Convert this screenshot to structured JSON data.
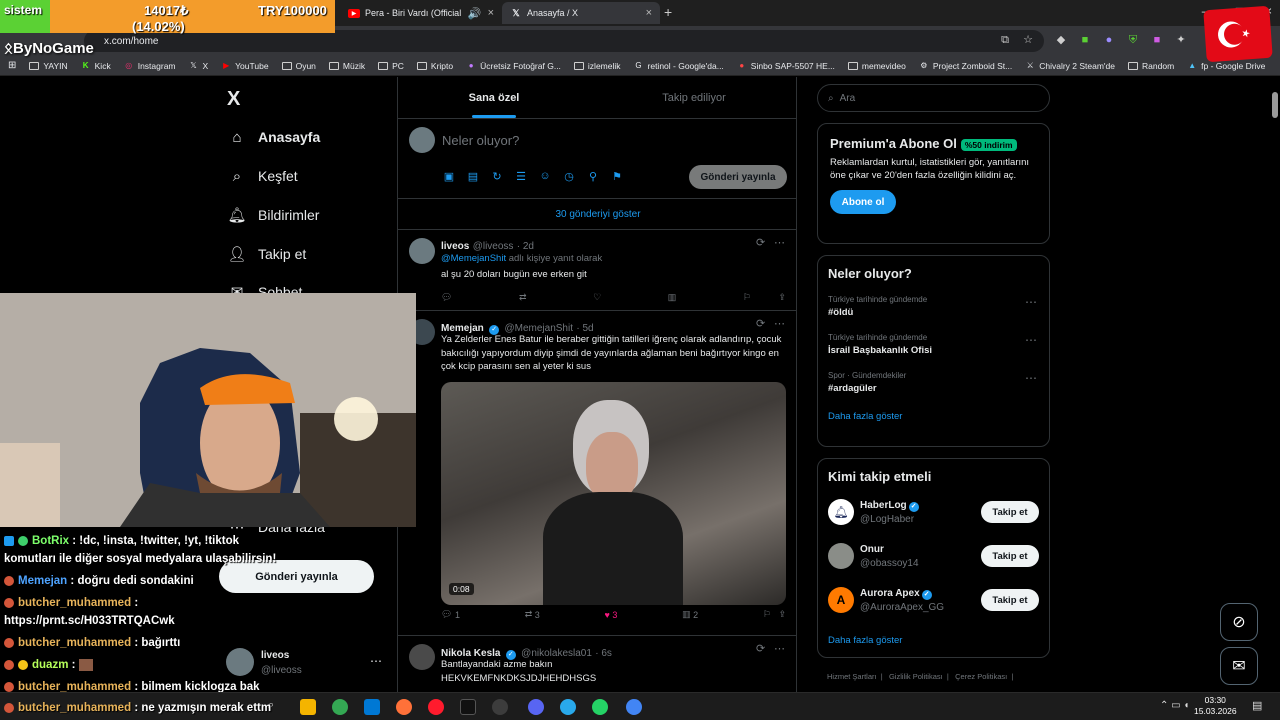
{
  "browser": {
    "tabs": [
      {
        "label": "Pera - Biri Vardı (Official Vid"
      },
      {
        "label": "Anasayfa / X"
      }
    ],
    "url": "x.com/home",
    "bookmarks": [
      "YAYIN",
      "Kick",
      "Instagram",
      "X",
      "YouTube",
      "Oyun",
      "Müzik",
      "PC",
      "Kripto",
      "Ücretsiz Fotoğraf G...",
      "izlemelik",
      "retinol - Google'da...",
      "Sinbo SAP-5507 HE...",
      "memevideo",
      "Project Zomboid St...",
      "Chivalry 2 Steam'de",
      "Random",
      "fp - Google Drive"
    ]
  },
  "stream_overlay": {
    "label": "sistem",
    "value": "14017₺",
    "percent": "(14.02%)",
    "goal": "TRY100000",
    "logo": "ByNoGame"
  },
  "sidebar": {
    "logo": "X",
    "items": [
      {
        "label": "Anasayfa",
        "icon": "home-icon"
      },
      {
        "label": "Keşfet",
        "icon": "search-icon"
      },
      {
        "label": "Bildirimler",
        "icon": "bell-icon"
      },
      {
        "label": "Takip et",
        "icon": "add-user-icon"
      },
      {
        "label": "Sohbet",
        "icon": "mail-icon"
      },
      {
        "label": "Daha fazla",
        "icon": "more-icon"
      }
    ],
    "post_button": "Gönderi yayınla",
    "account": {
      "name": "liveos",
      "handle": "@liveoss"
    }
  },
  "timeline": {
    "tabs": [
      "Sana özel",
      "Takip ediliyor"
    ],
    "compose_placeholder": "Neler oluyor?",
    "compose_button": "Gönderi yayınla",
    "show_more": "30 gönderiyi göster",
    "tweets": [
      {
        "name": "liveos",
        "handle": "@liveoss",
        "time": "· 2d",
        "reply_to": "@MemejanShit",
        "reply_suffix": " adlı kişiye yanıt olarak",
        "text": "al şu 20 doları bugün eve erken git"
      },
      {
        "name": "Memejan",
        "handle": "@MemejanShit",
        "time": "· 5d",
        "text": "Ya Zelderler Enes Batur ile beraber gittiğin tatilleri iğrenç olarak adlandırıp, çocuk bakıcılığı yapıyordum diyip şimdi de yayınlarda ağlaman beni bağırtıyor kingo en çok kcip parasını sen al yeter ki sus",
        "video_duration": "0:08",
        "replies": "1",
        "reposts": "3",
        "likes": "3",
        "views": "2"
      },
      {
        "name": "Nikola Kesla",
        "handle": "@nikolakesla01",
        "time": "· 6s",
        "text": "Bantlayandaki azme bakın\nHEKVKEMFNKDKSJDJHEHDHSGS"
      }
    ]
  },
  "right": {
    "search_placeholder": "Ara",
    "premium": {
      "title": "Premium'a Abone Ol",
      "badge": "%50 indirim",
      "text": "Reklamlardan kurtul, istatistikleri gör, yanıtlarını öne çıkar ve 20'den fazla özelliğin kilidini aç.",
      "button": "Abone ol"
    },
    "trends": {
      "title": "Neler oluyor?",
      "items": [
        {
          "context": "Türkiye tarihinde gündemde",
          "name": "#öldü"
        },
        {
          "context": "Türkiye tarihinde gündemde",
          "name": "İsrail Başbakanlık Ofisi"
        },
        {
          "context": "Spor · Gündemdekiler",
          "name": "#ardagüler"
        }
      ],
      "more": "Daha fazla göster"
    },
    "follow": {
      "title": "Kimi takip etmeli",
      "items": [
        {
          "name": "HaberLog",
          "handle": "@LogHaber",
          "verified": true
        },
        {
          "name": "Onur",
          "handle": "@obassoy14",
          "verified": false
        },
        {
          "name": "Aurora Apex",
          "handle": "@AuroraApex_GG",
          "verified": true
        }
      ],
      "button": "Takip et",
      "more": "Daha fazla göster"
    },
    "footer": [
      "Hizmet Şartları",
      "Gizlilik Politikası",
      "Çerez Politikası"
    ]
  },
  "chat": [
    {
      "user": "BotRix",
      "msg": ": !dc, !insta, !twitter, !yt, !tiktok"
    },
    {
      "user": "",
      "msg": "komutları ile diğer sosyal medyalara ulaşabilirsin!"
    },
    {
      "user": "Memejan",
      "msg": ": doğru dedi sondakini"
    },
    {
      "user": "butcher_muhammed",
      "msg": ":"
    },
    {
      "user": "",
      "msg": "https://prnt.sc/H033TRTQACwk"
    },
    {
      "user": "butcher_muhammed",
      "msg": ": bağırttı"
    },
    {
      "user": "duazm",
      "msg": ":"
    },
    {
      "user": "butcher_muhammed",
      "msg": ": bilmem kicklogza bak"
    },
    {
      "user": "butcher_muhammed",
      "msg": ": ne yazmışın merak ettm"
    }
  ],
  "taskbar": {
    "time": "03:30",
    "date": "15.03.2026"
  },
  "colors": {
    "accent": "#1d9bf0",
    "bg": "#000000",
    "border": "#2f3336"
  }
}
